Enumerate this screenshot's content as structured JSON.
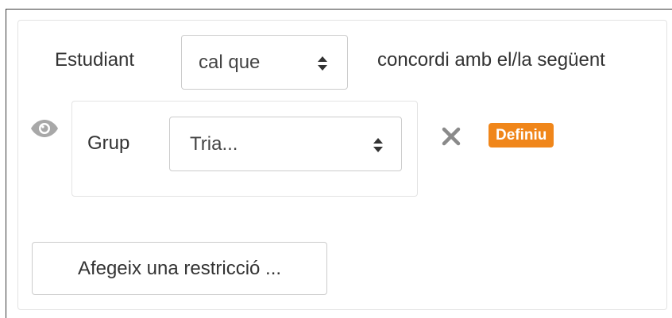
{
  "header": {
    "subject_label": "Estudiant",
    "condition_select": {
      "value": "cal que"
    },
    "tail_label": "concordi amb el/la següent"
  },
  "condition": {
    "eye_icon": "eye-icon",
    "type_label": "Grup",
    "group_select": {
      "value": "Tria..."
    },
    "close_icon": "close-icon",
    "badge": {
      "text": "Definiu",
      "color": "#f0861a"
    }
  },
  "footer": {
    "add_button_label": "Afegeix una restricció ..."
  }
}
